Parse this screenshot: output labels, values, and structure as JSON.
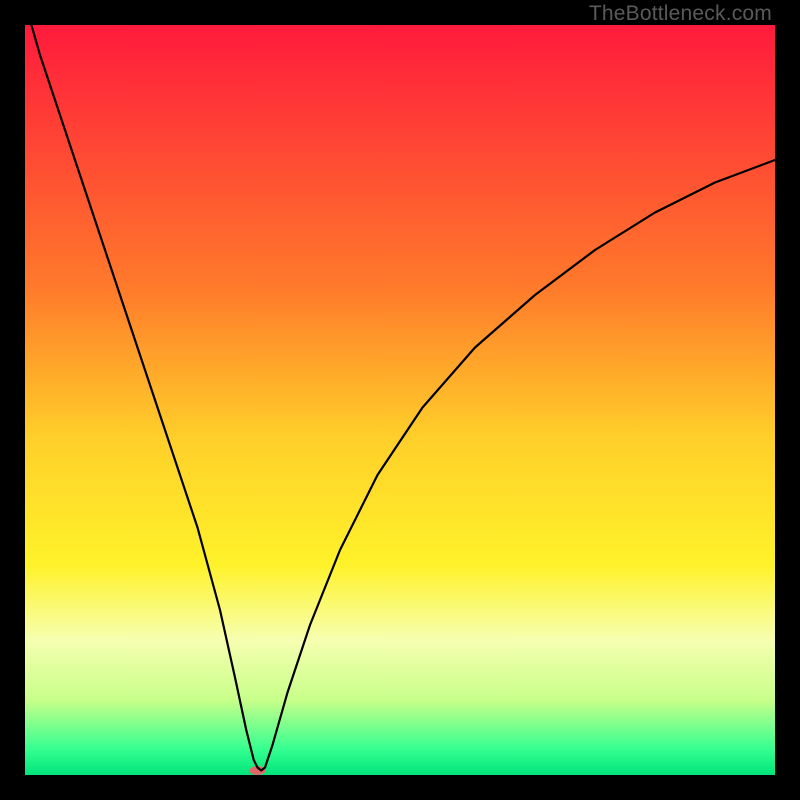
{
  "watermark": "TheBottleneck.com",
  "chart_data": {
    "type": "line",
    "title": "",
    "xlabel": "",
    "ylabel": "",
    "xlim": [
      0,
      100
    ],
    "ylim": [
      0,
      100
    ],
    "background_gradient": {
      "stops": [
        {
          "offset": 0,
          "color": "#ff1a3c"
        },
        {
          "offset": 35,
          "color": "#ff7a2b"
        },
        {
          "offset": 55,
          "color": "#ffcf2a"
        },
        {
          "offset": 72,
          "color": "#fff22a"
        },
        {
          "offset": 82,
          "color": "#f6ffb0"
        },
        {
          "offset": 90,
          "color": "#c8ff8a"
        },
        {
          "offset": 96.5,
          "color": "#36ff90"
        },
        {
          "offset": 100,
          "color": "#00e47a"
        }
      ]
    },
    "series": [
      {
        "name": "bottleneck-curve",
        "color": "#000000",
        "stroke_width": 2.2,
        "x": [
          0,
          2,
          5,
          8,
          11,
          14,
          17,
          20,
          23,
          26,
          28,
          29.5,
          30.5,
          31,
          31.5,
          32,
          33,
          35,
          38,
          42,
          47,
          53,
          60,
          68,
          76,
          84,
          92,
          100
        ],
        "y": [
          103,
          96,
          87,
          78,
          69,
          60,
          51,
          42,
          33,
          22,
          13,
          6,
          2,
          1,
          0.6,
          1,
          4,
          11,
          20,
          30,
          40,
          49,
          57,
          64,
          70,
          75,
          79,
          82
        ]
      }
    ],
    "marker": {
      "name": "selected-point",
      "x": 31,
      "y": 0.6,
      "rx": 8,
      "ry": 4.5,
      "fill": "#e06868"
    }
  }
}
